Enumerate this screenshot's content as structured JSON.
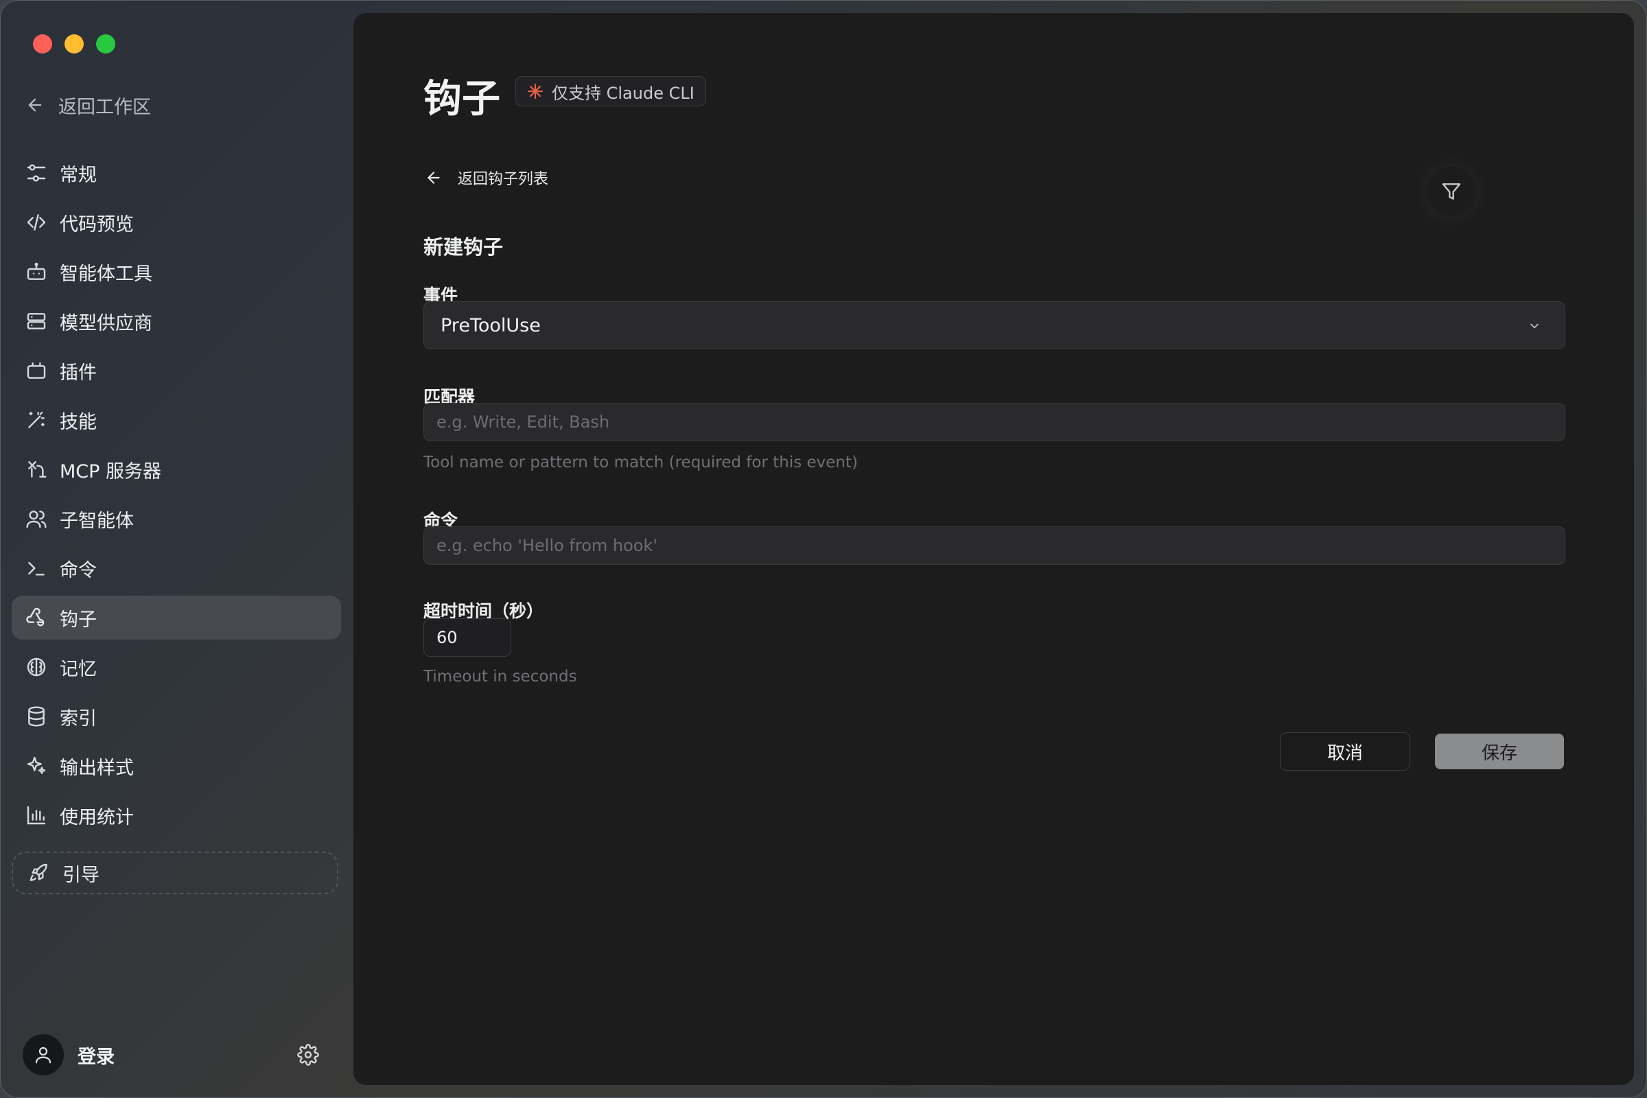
{
  "sidebar": {
    "back_label": "返回工作区",
    "items": [
      {
        "label": "常规",
        "icon": "sliders-icon"
      },
      {
        "label": "代码预览",
        "icon": "code-icon"
      },
      {
        "label": "智能体工具",
        "icon": "bot-icon"
      },
      {
        "label": "模型供应商",
        "icon": "server-icon"
      },
      {
        "label": "插件",
        "icon": "plugin-icon"
      },
      {
        "label": "技能",
        "icon": "wand-icon"
      },
      {
        "label": "MCP 服务器",
        "icon": "mcp-icon"
      },
      {
        "label": "子智能体",
        "icon": "users-icon"
      },
      {
        "label": "命令",
        "icon": "terminal-icon"
      },
      {
        "label": "钩子",
        "icon": "webhook-icon",
        "active": true
      },
      {
        "label": "记忆",
        "icon": "brain-icon"
      },
      {
        "label": "索引",
        "icon": "database-icon"
      },
      {
        "label": "输出样式",
        "icon": "sparkles-icon"
      },
      {
        "label": "使用统计",
        "icon": "bar-chart-icon"
      }
    ],
    "guide_label": "引导",
    "login_label": "登录"
  },
  "header": {
    "title": "钩子",
    "badge": "仅支持 Claude CLI",
    "badge_color": "#e8604c"
  },
  "form": {
    "back_label": "返回钩子列表",
    "section_title": "新建钩子",
    "event_label": "事件",
    "event_value": "PreToolUse",
    "matcher_label": "匹配器",
    "matcher_placeholder": "e.g. Write, Edit, Bash",
    "matcher_hint": "Tool name or pattern to match (required for this event)",
    "command_label": "命令",
    "command_placeholder": "e.g. echo 'Hello from hook'",
    "timeout_label": "超时时间（秒）",
    "timeout_value": "60",
    "timeout_hint": "Timeout in seconds",
    "cancel_label": "取消",
    "save_label": "保存"
  }
}
